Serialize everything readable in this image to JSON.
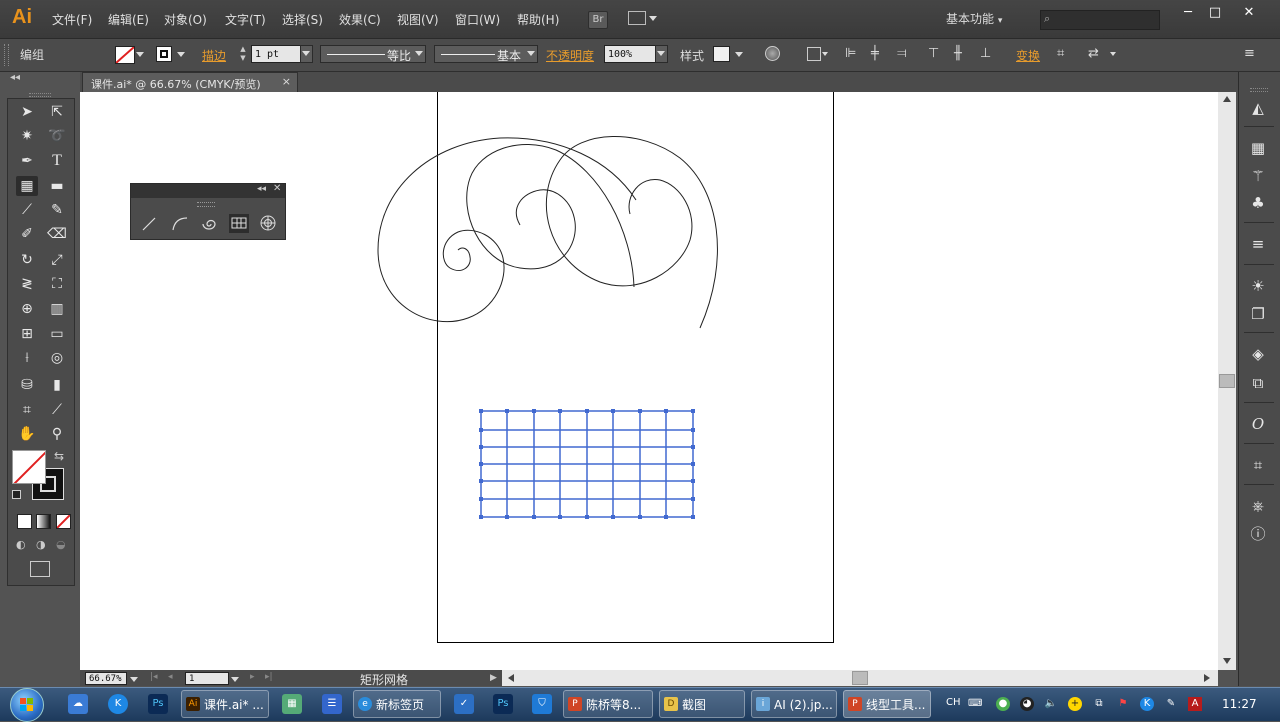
{
  "app": {
    "logo": "Ai",
    "bridge": "Br"
  },
  "menu": [
    "文件(F)",
    "编辑(E)",
    "对象(O)",
    "文字(T)",
    "选择(S)",
    "效果(C)",
    "视图(V)",
    "窗口(W)",
    "帮助(H)"
  ],
  "workspace": "基本功能",
  "window_controls": {
    "minimize": "─",
    "maximize": "□",
    "close": "✕"
  },
  "control": {
    "selection_type": "编组",
    "stroke_label": "描边",
    "stroke_weight": "1 pt",
    "profile_label": "等比",
    "brush_label": "基本",
    "opacity_label": "不透明度",
    "opacity_value": "100%",
    "style_label": "样式",
    "transform_label": "变换"
  },
  "document": {
    "tab_title": "课件.ai* @ 66.67% (CMYK/预览)",
    "close": "×"
  },
  "status": {
    "zoom": "66.67%",
    "artboard": "1",
    "tool_name": "矩形网格"
  },
  "colors": {
    "accent": "#e89c2c",
    "grid": "#4169d0",
    "selection": "#2d6bd6"
  },
  "taskbar": {
    "clock": "11:27",
    "lang": "CH",
    "tasks": [
      {
        "label": "课件.ai* ...",
        "icon": "Ai"
      },
      {
        "label": "新标签页",
        "icon": "e"
      },
      {
        "label": "陈桥等8...",
        "icon": "P"
      },
      {
        "label": "截图",
        "icon": "D"
      },
      {
        "label": "AI (2).jp...",
        "icon": "i"
      },
      {
        "label": "线型工具...",
        "icon": "P"
      }
    ]
  }
}
